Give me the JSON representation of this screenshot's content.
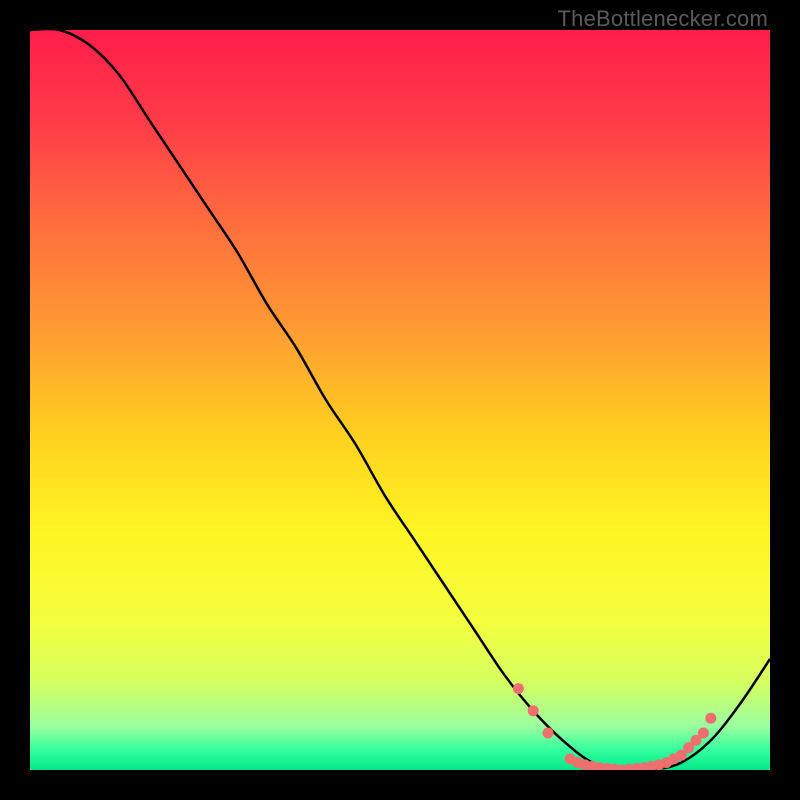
{
  "attribution": "TheBottlenecker.com",
  "chart_data": {
    "type": "line",
    "title": "",
    "xlabel": "",
    "ylabel": "",
    "xlim": [
      0,
      100
    ],
    "ylim": [
      0,
      100
    ],
    "series": [
      {
        "name": "bottleneck-curve",
        "x": [
          0,
          4,
          8,
          12,
          16,
          20,
          24,
          28,
          32,
          36,
          40,
          44,
          48,
          52,
          56,
          60,
          64,
          68,
          72,
          76,
          80,
          84,
          88,
          92,
          96,
          100
        ],
        "values": [
          100,
          100,
          98,
          94,
          88,
          82,
          76,
          70,
          63,
          57,
          50,
          44,
          37,
          31,
          25,
          19,
          13,
          8,
          4,
          1,
          0,
          0,
          1,
          4,
          9,
          15
        ]
      }
    ],
    "markers": {
      "name": "highlight-dots",
      "x": [
        66,
        68,
        70,
        73,
        74,
        75,
        76,
        77,
        78,
        79,
        80,
        81,
        82,
        83,
        84,
        85,
        86,
        87,
        88,
        89,
        90,
        91,
        92
      ],
      "values": [
        11,
        8,
        5,
        1.5,
        1,
        0.7,
        0.5,
        0.3,
        0.2,
        0.1,
        0,
        0.1,
        0.2,
        0.3,
        0.5,
        0.7,
        1,
        1.5,
        2,
        3,
        4,
        5,
        7
      ]
    },
    "gradient_stops": [
      {
        "offset": 0.0,
        "color": "#ff1e4c"
      },
      {
        "offset": 0.12,
        "color": "#ff3b49"
      },
      {
        "offset": 0.25,
        "color": "#ff6a3f"
      },
      {
        "offset": 0.4,
        "color": "#ff9a33"
      },
      {
        "offset": 0.55,
        "color": "#ffd21f"
      },
      {
        "offset": 0.68,
        "color": "#fff625"
      },
      {
        "offset": 0.8,
        "color": "#f4ff40"
      },
      {
        "offset": 0.88,
        "color": "#d6ff60"
      },
      {
        "offset": 0.94,
        "color": "#9dffa0"
      },
      {
        "offset": 0.975,
        "color": "#2fff9e"
      },
      {
        "offset": 1.0,
        "color": "#06e88c"
      }
    ],
    "marker_color": "#ef6f6f",
    "curve_color": "#000000"
  }
}
